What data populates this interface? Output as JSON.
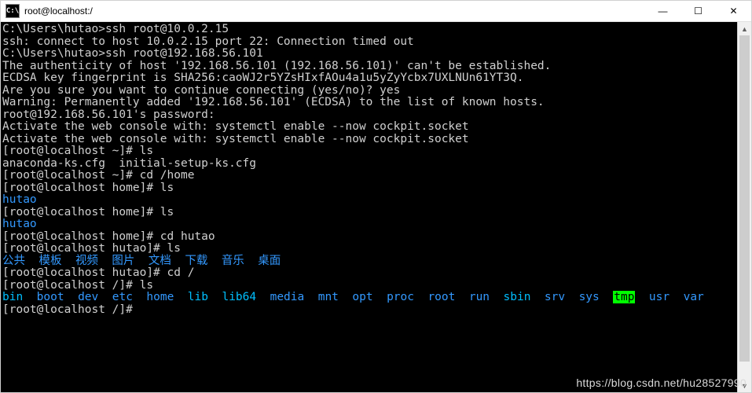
{
  "window": {
    "icon_label": "C:\\",
    "title": "root@localhost:/",
    "controls": {
      "minimize": "—",
      "maximize": "☐",
      "close": "✕"
    }
  },
  "terminal": {
    "lines": [
      {
        "seg": [
          {
            "t": "C:\\Users\\hutao>ssh root@10.0.2.15",
            "c": "c-white"
          }
        ]
      },
      {
        "seg": [
          {
            "t": "ssh: connect to host 10.0.2.15 port 22: Connection timed out",
            "c": "c-white"
          }
        ]
      },
      {
        "seg": [
          {
            "t": "",
            "c": "c-white"
          }
        ]
      },
      {
        "seg": [
          {
            "t": "C:\\Users\\hutao>ssh root@192.168.56.101",
            "c": "c-white"
          }
        ]
      },
      {
        "seg": [
          {
            "t": "The authenticity of host '192.168.56.101 (192.168.56.101)' can't be established.",
            "c": "c-white"
          }
        ]
      },
      {
        "seg": [
          {
            "t": "ECDSA key fingerprint is SHA256:caoWJ2r5YZsHIxfAOu4a1u5yZyYcbx7UXLNUn61YT3Q.",
            "c": "c-white"
          }
        ]
      },
      {
        "seg": [
          {
            "t": "Are you sure you want to continue connecting (yes/no)? yes",
            "c": "c-white"
          }
        ]
      },
      {
        "seg": [
          {
            "t": "Warning: Permanently added '192.168.56.101' (ECDSA) to the list of known hosts.",
            "c": "c-white"
          }
        ]
      },
      {
        "seg": [
          {
            "t": "root@192.168.56.101's password:",
            "c": "c-white"
          }
        ]
      },
      {
        "seg": [
          {
            "t": "Activate the web console with: systemctl enable --now cockpit.socket",
            "c": "c-white"
          }
        ]
      },
      {
        "seg": [
          {
            "t": "",
            "c": "c-white"
          }
        ]
      },
      {
        "seg": [
          {
            "t": "Activate the web console with: systemctl enable --now cockpit.socket",
            "c": "c-white"
          }
        ]
      },
      {
        "seg": [
          {
            "t": "",
            "c": "c-white"
          }
        ]
      },
      {
        "seg": [
          {
            "t": "[root@localhost ~]# ls",
            "c": "c-white"
          }
        ]
      },
      {
        "seg": [
          {
            "t": "anaconda-ks.cfg  initial-setup-ks.cfg",
            "c": "c-white"
          }
        ]
      },
      {
        "seg": [
          {
            "t": "[root@localhost ~]# cd /home",
            "c": "c-white"
          }
        ]
      },
      {
        "seg": [
          {
            "t": "[root@localhost home]# ls",
            "c": "c-white"
          }
        ]
      },
      {
        "seg": [
          {
            "t": "hutao",
            "c": "c-cyan"
          }
        ]
      },
      {
        "seg": [
          {
            "t": "[root@localhost home]# ls",
            "c": "c-white"
          }
        ]
      },
      {
        "seg": [
          {
            "t": "hutao",
            "c": "c-cyan"
          }
        ]
      },
      {
        "seg": [
          {
            "t": "[root@localhost home]# cd hutao",
            "c": "c-white"
          }
        ]
      },
      {
        "seg": [
          {
            "t": "[root@localhost hutao]# ls",
            "c": "c-white"
          }
        ]
      },
      {
        "seg": [
          {
            "t": "公共",
            "c": "c-cyan"
          },
          {
            "t": "  ",
            "c": ""
          },
          {
            "t": "模板",
            "c": "c-cyan"
          },
          {
            "t": "  ",
            "c": ""
          },
          {
            "t": "视频",
            "c": "c-cyan"
          },
          {
            "t": "  ",
            "c": ""
          },
          {
            "t": "图片",
            "c": "c-cyan"
          },
          {
            "t": "  ",
            "c": ""
          },
          {
            "t": "文档",
            "c": "c-cyan"
          },
          {
            "t": "  ",
            "c": ""
          },
          {
            "t": "下载",
            "c": "c-cyan"
          },
          {
            "t": "  ",
            "c": ""
          },
          {
            "t": "音乐",
            "c": "c-cyan"
          },
          {
            "t": "  ",
            "c": ""
          },
          {
            "t": "桌面",
            "c": "c-cyan"
          }
        ]
      },
      {
        "seg": [
          {
            "t": "[root@localhost hutao]# cd /",
            "c": "c-white"
          }
        ]
      },
      {
        "seg": [
          {
            "t": "[root@localhost /]# ls",
            "c": "c-white"
          }
        ]
      },
      {
        "seg": [
          {
            "t": "bin",
            "c": "c-cyanb"
          },
          {
            "t": "  ",
            "c": ""
          },
          {
            "t": "boot",
            "c": "c-cyan"
          },
          {
            "t": "  ",
            "c": ""
          },
          {
            "t": "dev",
            "c": "c-cyan"
          },
          {
            "t": "  ",
            "c": ""
          },
          {
            "t": "etc",
            "c": "c-cyan"
          },
          {
            "t": "  ",
            "c": ""
          },
          {
            "t": "home",
            "c": "c-cyan"
          },
          {
            "t": "  ",
            "c": ""
          },
          {
            "t": "lib",
            "c": "c-cyanb"
          },
          {
            "t": "  ",
            "c": ""
          },
          {
            "t": "lib64",
            "c": "c-cyanb"
          },
          {
            "t": "  ",
            "c": ""
          },
          {
            "t": "media",
            "c": "c-cyan"
          },
          {
            "t": "  ",
            "c": ""
          },
          {
            "t": "mnt",
            "c": "c-cyan"
          },
          {
            "t": "  ",
            "c": ""
          },
          {
            "t": "opt",
            "c": "c-cyan"
          },
          {
            "t": "  ",
            "c": ""
          },
          {
            "t": "proc",
            "c": "c-cyan"
          },
          {
            "t": "  ",
            "c": ""
          },
          {
            "t": "root",
            "c": "c-cyan"
          },
          {
            "t": "  ",
            "c": ""
          },
          {
            "t": "run",
            "c": "c-cyan"
          },
          {
            "t": "  ",
            "c": ""
          },
          {
            "t": "sbin",
            "c": "c-cyanb"
          },
          {
            "t": "  ",
            "c": ""
          },
          {
            "t": "srv",
            "c": "c-cyan"
          },
          {
            "t": "  ",
            "c": ""
          },
          {
            "t": "sys",
            "c": "c-cyan"
          },
          {
            "t": "  ",
            "c": ""
          },
          {
            "t": "tmp",
            "c": "c-tmp"
          },
          {
            "t": "  ",
            "c": ""
          },
          {
            "t": "usr",
            "c": "c-cyan"
          },
          {
            "t": "  ",
            "c": ""
          },
          {
            "t": "var",
            "c": "c-cyan"
          }
        ]
      },
      {
        "seg": [
          {
            "t": "[root@localhost /]# ",
            "c": "c-white"
          }
        ]
      }
    ]
  },
  "watermark": "https://blog.csdn.net/hu28527990"
}
